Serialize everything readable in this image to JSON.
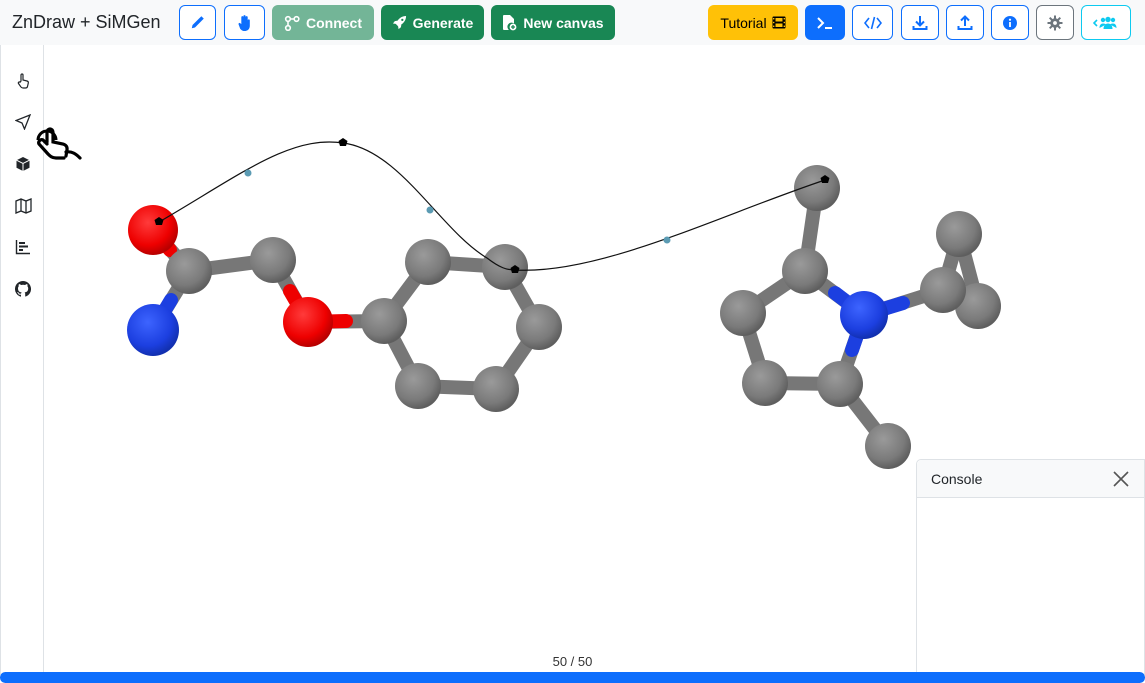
{
  "app": {
    "brand": "ZnDraw + SiMGen"
  },
  "toolbar": {
    "pencil_icon": "pencil-icon",
    "hand_icon": "hand-icon",
    "connect_label": "Connect",
    "generate_label": "Generate",
    "new_canvas_label": "New canvas",
    "tutorial_label": "Tutorial",
    "terminal_icon": "terminal-icon",
    "code_icon": "code-icon",
    "download_icon": "download-icon",
    "upload_icon": "upload-icon",
    "info_icon": "info-icon",
    "settings_icon": "gear-icon",
    "users_icon": "users-icon"
  },
  "sidebar": {
    "items": [
      {
        "icon": "pointer-hand-icon"
      },
      {
        "icon": "send-arrow-icon"
      },
      {
        "icon": "cube-icon"
      },
      {
        "icon": "map-icon"
      },
      {
        "icon": "bar-chart-icon"
      },
      {
        "icon": "github-icon"
      }
    ]
  },
  "console": {
    "title": "Console"
  },
  "player": {
    "frame_text": "50 / 50",
    "current_frame": 50,
    "total_frames": 50,
    "progress_fraction": 1.0
  },
  "colors": {
    "primary": "#0d6efd",
    "success": "#198754",
    "warning": "#ffc107",
    "carbon": "#7a7a7a",
    "oxygen": "#ff0000",
    "nitrogen": "#1c3fe0"
  }
}
